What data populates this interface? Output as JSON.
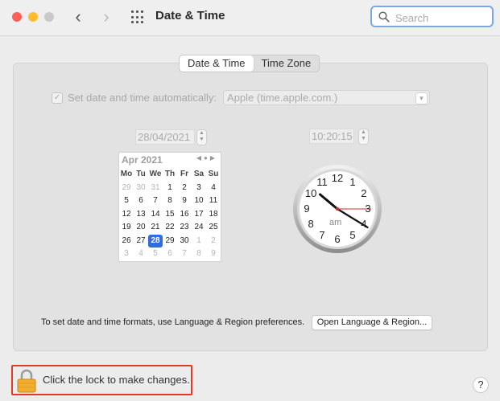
{
  "window": {
    "title": "Date & Time"
  },
  "toolbar": {
    "back": "‹",
    "forward": "›",
    "search_placeholder": "Search"
  },
  "tabs": [
    {
      "label": "Date & Time"
    },
    {
      "label": "Time Zone"
    }
  ],
  "auto": {
    "label": "Set date and time automatically:",
    "checked": true,
    "server": "Apple (time.apple.com.)"
  },
  "date_field": "28/04/2021",
  "time_field": "10:20:15",
  "calendar": {
    "month": "Apr 2021",
    "weekdays": [
      "Mo",
      "Tu",
      "We",
      "Th",
      "Fr",
      "Sa",
      "Su"
    ],
    "days": [
      "29",
      "30",
      "31",
      "1",
      "2",
      "3",
      "4",
      "5",
      "6",
      "7",
      "8",
      "9",
      "10",
      "11",
      "12",
      "13",
      "14",
      "15",
      "16",
      "17",
      "18",
      "19",
      "20",
      "21",
      "22",
      "23",
      "24",
      "25",
      "26",
      "27",
      "28",
      "29",
      "30",
      "1",
      "2",
      "3",
      "4",
      "5",
      "6",
      "7",
      "8",
      "9"
    ],
    "selected": "28"
  },
  "clock": {
    "numbers": [
      "12",
      "1",
      "2",
      "3",
      "4",
      "5",
      "6",
      "7",
      "8",
      "9",
      "10",
      "11"
    ],
    "ampm": "am",
    "hours": 10,
    "minutes": 20,
    "seconds": 15
  },
  "footer": {
    "formats_text": "To set date and time formats, use Language & Region preferences.",
    "open_button": "Open Language & Region...",
    "lock_text": "Click the lock to make changes.",
    "help": "?"
  },
  "colors": {
    "accent": "#2e6ce0",
    "highlight_border": "#e33b1f",
    "second_hand": "#d22b2b"
  }
}
